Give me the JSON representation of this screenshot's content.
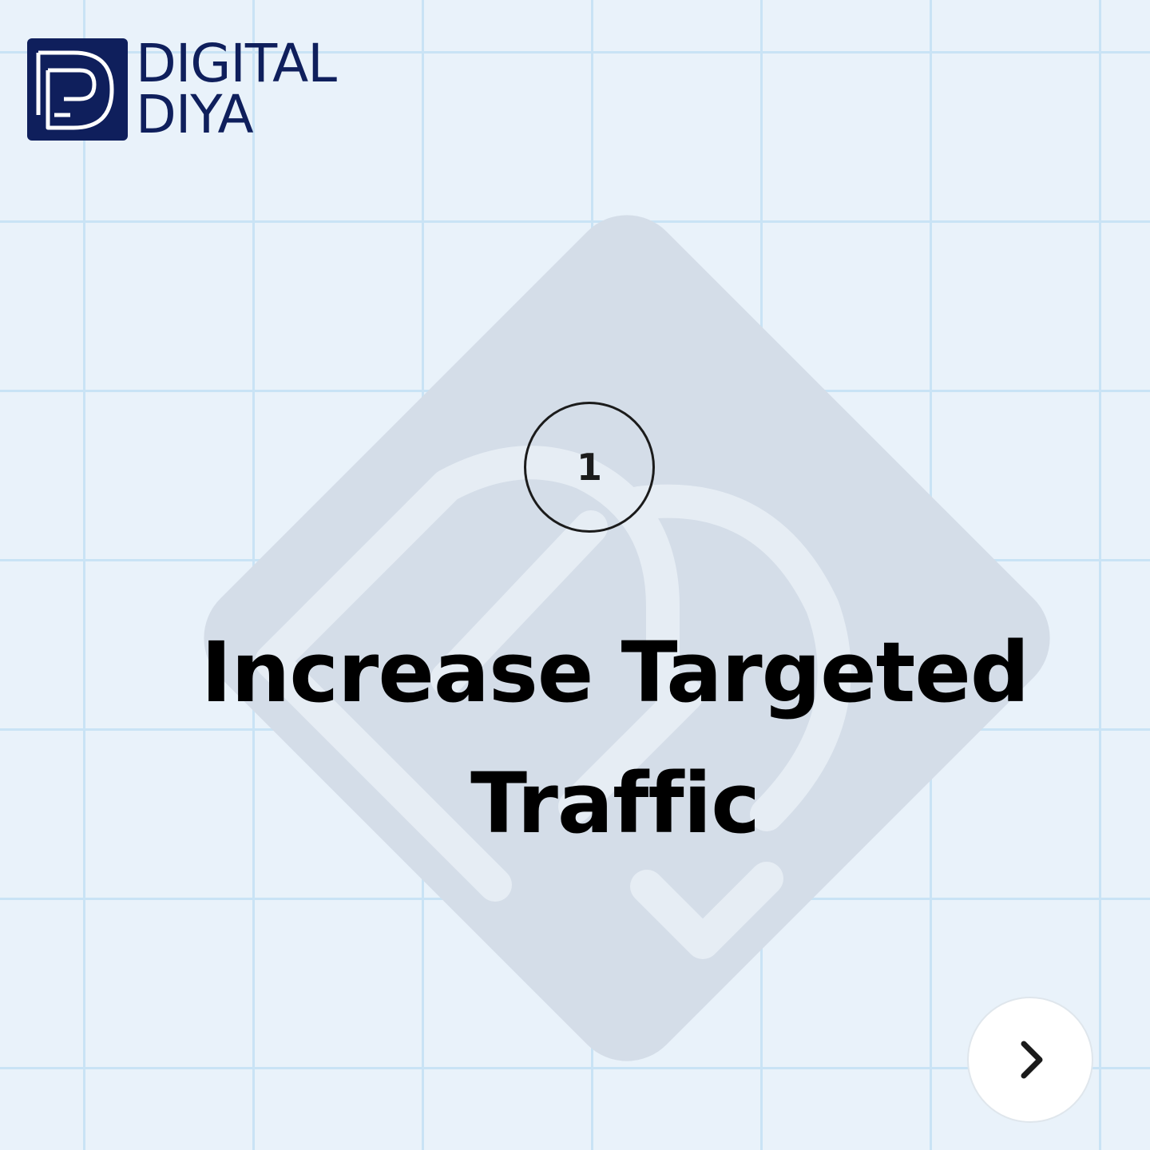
{
  "brand": {
    "line1": "DIGITAL",
    "line2": "DIYA",
    "primary_color": "#0f1f5c"
  },
  "step": {
    "number": "1"
  },
  "headline": {
    "line1": "Increase Targeted",
    "line2": "Traffic"
  },
  "navigation": {
    "next_icon": "chevron-right-icon"
  },
  "colors": {
    "background": "#e9f2fa",
    "grid": "#c9e3f5",
    "watermark": "#d4dde8",
    "text": "#000000"
  }
}
